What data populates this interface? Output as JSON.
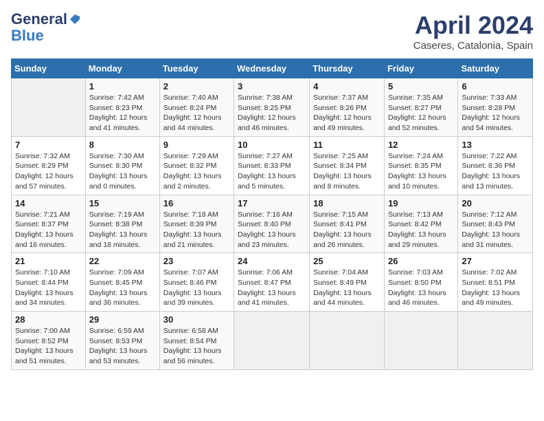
{
  "header": {
    "logo_general": "General",
    "logo_blue": "Blue",
    "title": "April 2024",
    "subtitle": "Caseres, Catalonia, Spain"
  },
  "days_of_week": [
    "Sunday",
    "Monday",
    "Tuesday",
    "Wednesday",
    "Thursday",
    "Friday",
    "Saturday"
  ],
  "weeks": [
    [
      {
        "num": "",
        "detail": ""
      },
      {
        "num": "1",
        "detail": "Sunrise: 7:42 AM\nSunset: 8:23 PM\nDaylight: 12 hours\nand 41 minutes."
      },
      {
        "num": "2",
        "detail": "Sunrise: 7:40 AM\nSunset: 8:24 PM\nDaylight: 12 hours\nand 44 minutes."
      },
      {
        "num": "3",
        "detail": "Sunrise: 7:38 AM\nSunset: 8:25 PM\nDaylight: 12 hours\nand 46 minutes."
      },
      {
        "num": "4",
        "detail": "Sunrise: 7:37 AM\nSunset: 8:26 PM\nDaylight: 12 hours\nand 49 minutes."
      },
      {
        "num": "5",
        "detail": "Sunrise: 7:35 AM\nSunset: 8:27 PM\nDaylight: 12 hours\nand 52 minutes."
      },
      {
        "num": "6",
        "detail": "Sunrise: 7:33 AM\nSunset: 8:28 PM\nDaylight: 12 hours\nand 54 minutes."
      }
    ],
    [
      {
        "num": "7",
        "detail": "Sunrise: 7:32 AM\nSunset: 8:29 PM\nDaylight: 12 hours\nand 57 minutes."
      },
      {
        "num": "8",
        "detail": "Sunrise: 7:30 AM\nSunset: 8:30 PM\nDaylight: 13 hours\nand 0 minutes."
      },
      {
        "num": "9",
        "detail": "Sunrise: 7:29 AM\nSunset: 8:32 PM\nDaylight: 13 hours\nand 2 minutes."
      },
      {
        "num": "10",
        "detail": "Sunrise: 7:27 AM\nSunset: 8:33 PM\nDaylight: 13 hours\nand 5 minutes."
      },
      {
        "num": "11",
        "detail": "Sunrise: 7:25 AM\nSunset: 8:34 PM\nDaylight: 13 hours\nand 8 minutes."
      },
      {
        "num": "12",
        "detail": "Sunrise: 7:24 AM\nSunset: 8:35 PM\nDaylight: 13 hours\nand 10 minutes."
      },
      {
        "num": "13",
        "detail": "Sunrise: 7:22 AM\nSunset: 8:36 PM\nDaylight: 13 hours\nand 13 minutes."
      }
    ],
    [
      {
        "num": "14",
        "detail": "Sunrise: 7:21 AM\nSunset: 8:37 PM\nDaylight: 13 hours\nand 16 minutes."
      },
      {
        "num": "15",
        "detail": "Sunrise: 7:19 AM\nSunset: 8:38 PM\nDaylight: 13 hours\nand 18 minutes."
      },
      {
        "num": "16",
        "detail": "Sunrise: 7:18 AM\nSunset: 8:39 PM\nDaylight: 13 hours\nand 21 minutes."
      },
      {
        "num": "17",
        "detail": "Sunrise: 7:16 AM\nSunset: 8:40 PM\nDaylight: 13 hours\nand 23 minutes."
      },
      {
        "num": "18",
        "detail": "Sunrise: 7:15 AM\nSunset: 8:41 PM\nDaylight: 13 hours\nand 26 minutes."
      },
      {
        "num": "19",
        "detail": "Sunrise: 7:13 AM\nSunset: 8:42 PM\nDaylight: 13 hours\nand 29 minutes."
      },
      {
        "num": "20",
        "detail": "Sunrise: 7:12 AM\nSunset: 8:43 PM\nDaylight: 13 hours\nand 31 minutes."
      }
    ],
    [
      {
        "num": "21",
        "detail": "Sunrise: 7:10 AM\nSunset: 8:44 PM\nDaylight: 13 hours\nand 34 minutes."
      },
      {
        "num": "22",
        "detail": "Sunrise: 7:09 AM\nSunset: 8:45 PM\nDaylight: 13 hours\nand 36 minutes."
      },
      {
        "num": "23",
        "detail": "Sunrise: 7:07 AM\nSunset: 8:46 PM\nDaylight: 13 hours\nand 39 minutes."
      },
      {
        "num": "24",
        "detail": "Sunrise: 7:06 AM\nSunset: 8:47 PM\nDaylight: 13 hours\nand 41 minutes."
      },
      {
        "num": "25",
        "detail": "Sunrise: 7:04 AM\nSunset: 8:49 PM\nDaylight: 13 hours\nand 44 minutes."
      },
      {
        "num": "26",
        "detail": "Sunrise: 7:03 AM\nSunset: 8:50 PM\nDaylight: 13 hours\nand 46 minutes."
      },
      {
        "num": "27",
        "detail": "Sunrise: 7:02 AM\nSunset: 8:51 PM\nDaylight: 13 hours\nand 49 minutes."
      }
    ],
    [
      {
        "num": "28",
        "detail": "Sunrise: 7:00 AM\nSunset: 8:52 PM\nDaylight: 13 hours\nand 51 minutes."
      },
      {
        "num": "29",
        "detail": "Sunrise: 6:59 AM\nSunset: 8:53 PM\nDaylight: 13 hours\nand 53 minutes."
      },
      {
        "num": "30",
        "detail": "Sunrise: 6:58 AM\nSunset: 8:54 PM\nDaylight: 13 hours\nand 56 minutes."
      },
      {
        "num": "",
        "detail": ""
      },
      {
        "num": "",
        "detail": ""
      },
      {
        "num": "",
        "detail": ""
      },
      {
        "num": "",
        "detail": ""
      }
    ]
  ]
}
